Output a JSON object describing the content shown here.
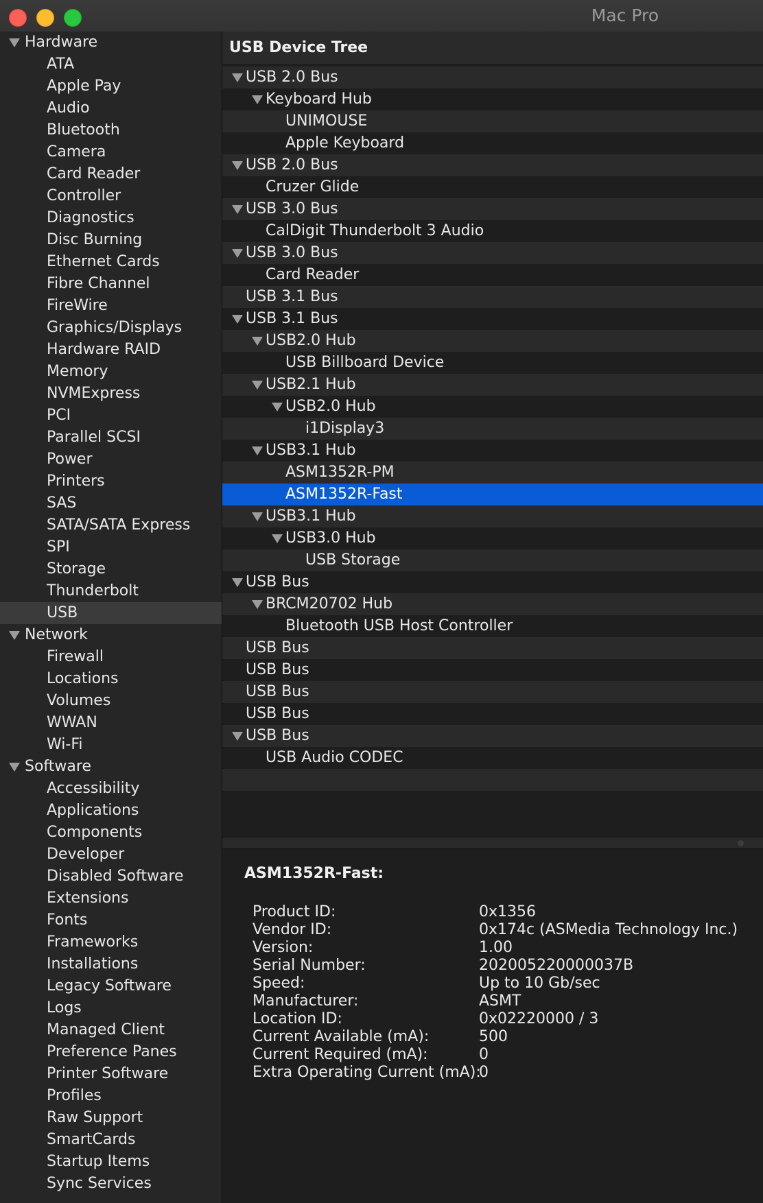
{
  "window": {
    "title": "Mac Pro"
  },
  "sidebar": {
    "sections": [
      {
        "label": "Hardware",
        "items": [
          "ATA",
          "Apple Pay",
          "Audio",
          "Bluetooth",
          "Camera",
          "Card Reader",
          "Controller",
          "Diagnostics",
          "Disc Burning",
          "Ethernet Cards",
          "Fibre Channel",
          "FireWire",
          "Graphics/Displays",
          "Hardware RAID",
          "Memory",
          "NVMExpress",
          "PCI",
          "Parallel SCSI",
          "Power",
          "Printers",
          "SAS",
          "SATA/SATA Express",
          "SPI",
          "Storage",
          "Thunderbolt",
          "USB"
        ]
      },
      {
        "label": "Network",
        "items": [
          "Firewall",
          "Locations",
          "Volumes",
          "WWAN",
          "Wi-Fi"
        ]
      },
      {
        "label": "Software",
        "items": [
          "Accessibility",
          "Applications",
          "Components",
          "Developer",
          "Disabled Software",
          "Extensions",
          "Fonts",
          "Frameworks",
          "Installations",
          "Legacy Software",
          "Logs",
          "Managed Client",
          "Preference Panes",
          "Printer Software",
          "Profiles",
          "Raw Support",
          "SmartCards",
          "Startup Items",
          "Sync Services"
        ]
      }
    ],
    "selected": "USB"
  },
  "tree": {
    "header": "USB Device Tree",
    "rows": [
      {
        "label": "USB 2.0 Bus",
        "depth": 0,
        "expanded": true
      },
      {
        "label": "Keyboard Hub",
        "depth": 1,
        "expanded": true
      },
      {
        "label": "UNIMOUSE",
        "depth": 2
      },
      {
        "label": "Apple Keyboard",
        "depth": 2
      },
      {
        "label": "USB 2.0 Bus",
        "depth": 0,
        "expanded": true
      },
      {
        "label": "Cruzer Glide",
        "depth": 1
      },
      {
        "label": "USB 3.0 Bus",
        "depth": 0,
        "expanded": true
      },
      {
        "label": "CalDigit Thunderbolt 3 Audio",
        "depth": 1
      },
      {
        "label": "USB 3.0 Bus",
        "depth": 0,
        "expanded": true
      },
      {
        "label": "Card Reader",
        "depth": 1
      },
      {
        "label": "USB 3.1 Bus",
        "depth": 0
      },
      {
        "label": "USB 3.1 Bus",
        "depth": 0,
        "expanded": true
      },
      {
        "label": "USB2.0 Hub",
        "depth": 1,
        "expanded": true
      },
      {
        "label": "USB Billboard Device",
        "depth": 2
      },
      {
        "label": "USB2.1 Hub",
        "depth": 1,
        "expanded": true
      },
      {
        "label": "USB2.0 Hub",
        "depth": 2,
        "expanded": true
      },
      {
        "label": "i1Display3",
        "depth": 3
      },
      {
        "label": "USB3.1 Hub",
        "depth": 1,
        "expanded": true
      },
      {
        "label": "ASM1352R-PM",
        "depth": 2
      },
      {
        "label": "ASM1352R-Fast",
        "depth": 2,
        "selected": true
      },
      {
        "label": "USB3.1 Hub",
        "depth": 1,
        "expanded": true
      },
      {
        "label": "USB3.0 Hub",
        "depth": 2,
        "expanded": true
      },
      {
        "label": "USB Storage",
        "depth": 3
      },
      {
        "label": "USB Bus",
        "depth": 0,
        "expanded": true
      },
      {
        "label": "BRCM20702 Hub",
        "depth": 1,
        "expanded": true
      },
      {
        "label": "Bluetooth USB Host Controller",
        "depth": 2
      },
      {
        "label": "USB Bus",
        "depth": 0
      },
      {
        "label": "USB Bus",
        "depth": 0
      },
      {
        "label": "USB Bus",
        "depth": 0
      },
      {
        "label": "USB Bus",
        "depth": 0
      },
      {
        "label": "USB Bus",
        "depth": 0,
        "expanded": true
      },
      {
        "label": "USB Audio CODEC",
        "depth": 1
      },
      {
        "label": "",
        "depth": 0
      },
      {
        "label": "",
        "depth": 0
      }
    ]
  },
  "detail": {
    "title": "ASM1352R-Fast:",
    "properties": [
      {
        "key": "Product ID:",
        "value": "0x1356"
      },
      {
        "key": "Vendor ID:",
        "value": "0x174c  (ASMedia Technology Inc.)"
      },
      {
        "key": "Version:",
        "value": "1.00"
      },
      {
        "key": "Serial Number:",
        "value": "202005220000037B"
      },
      {
        "key": "Speed:",
        "value": "Up to 10 Gb/sec"
      },
      {
        "key": "Manufacturer:",
        "value": "ASMT"
      },
      {
        "key": "Location ID:",
        "value": "0x02220000 / 3"
      },
      {
        "key": "Current Available (mA):",
        "value": "500"
      },
      {
        "key": "Current Required (mA):",
        "value": "0"
      },
      {
        "key": "Extra Operating Current (mA):",
        "value": "0"
      }
    ]
  }
}
